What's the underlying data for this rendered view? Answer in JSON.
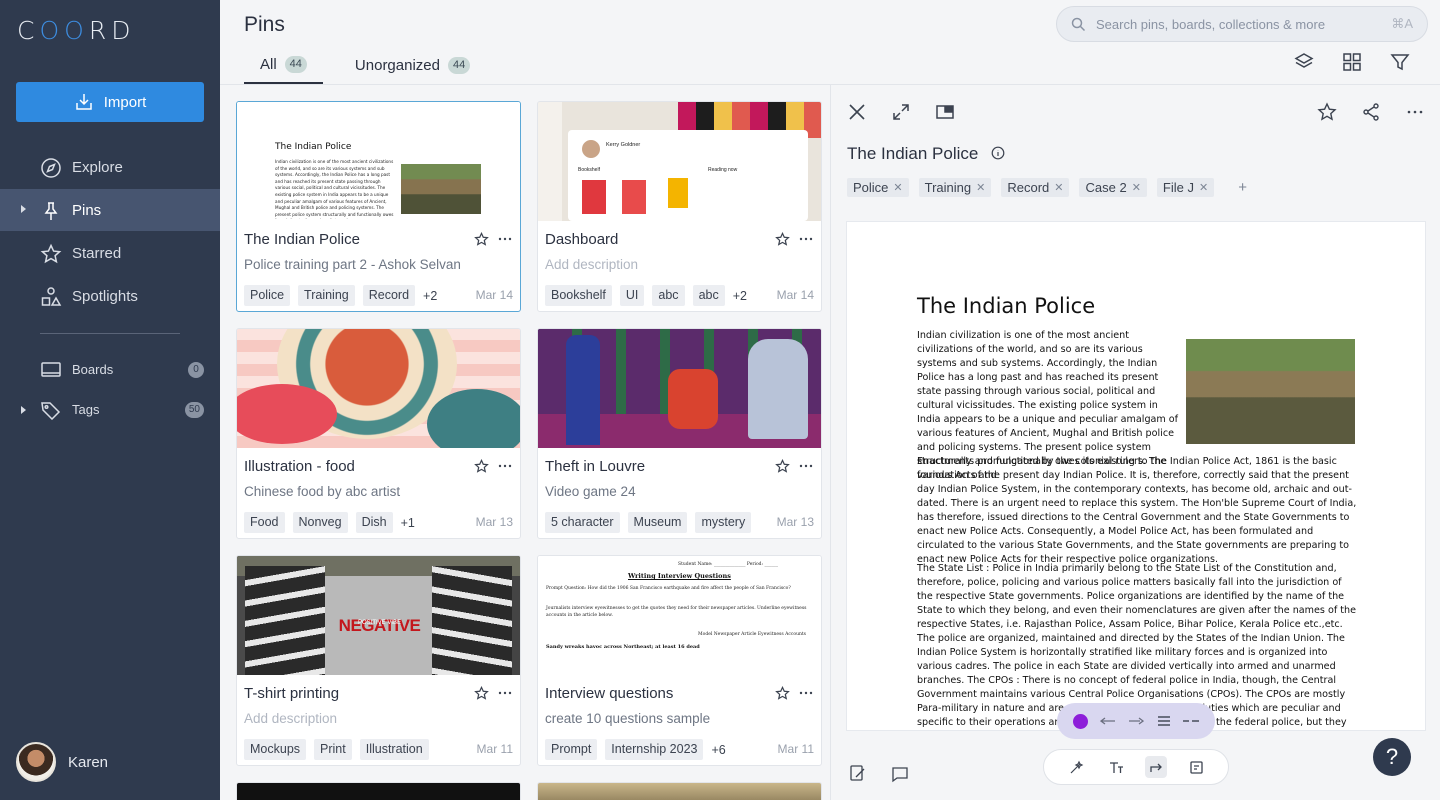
{
  "app": {
    "logo": "COORD"
  },
  "sidebar": {
    "import_label": "Import",
    "nav": [
      {
        "label": "Explore",
        "icon": "compass-icon"
      },
      {
        "label": "Pins",
        "icon": "pin-icon"
      },
      {
        "label": "Starred",
        "icon": "star-icon"
      },
      {
        "label": "Spotlights",
        "icon": "shapes-icon"
      }
    ],
    "boards": {
      "label": "Boards",
      "count": "0"
    },
    "tags": {
      "label": "Tags",
      "count": "50"
    },
    "user": {
      "name": "Karen"
    }
  },
  "header": {
    "title": "Pins",
    "search_placeholder": "Search pins, boards, collections & more",
    "search_shortcut": "⌘A",
    "tabs": [
      {
        "label": "All",
        "count": "44"
      },
      {
        "label": "Unorganized",
        "count": "44"
      }
    ]
  },
  "cards": [
    {
      "title": "The Indian Police",
      "desc": "Police training part 2 - Ashok Selvan",
      "tags": [
        "Police",
        "Training",
        "Record"
      ],
      "more": "+2",
      "date": "Mar 14"
    },
    {
      "title": "Dashboard",
      "desc": "Add description",
      "tags": [
        "Bookshelf",
        "UI",
        "abc",
        "abc"
      ],
      "more": "+2",
      "date": "Mar 14"
    },
    {
      "title": "Illustration - food",
      "desc": "Chinese food by abc artist",
      "tags": [
        "Food",
        "Nonveg",
        "Dish"
      ],
      "more": "+1",
      "date": "Mar 13"
    },
    {
      "title": "Theft in Louvre",
      "desc": "Video game 24",
      "tags": [
        "5 character",
        "Museum",
        "mystery"
      ],
      "more": "",
      "date": "Mar 13"
    },
    {
      "title": "T-shirt printing",
      "desc": "Add description",
      "tags": [
        "Mockups",
        "Print",
        "Illustration"
      ],
      "more": "",
      "date": "Mar 11"
    },
    {
      "title": "Interview questions",
      "desc": "create 10 questions sample",
      "tags": [
        "Prompt",
        "Internship 2023"
      ],
      "more": "+6",
      "date": "Mar 11"
    }
  ],
  "thumbs": {
    "police_doc_title": "The Indian Police",
    "police_doc_text": "Indian civilization is one of the most ancient civilizations of the world, and so are its various systems and sub systems. Accordingly, the Indian Police has a long past and has reached its present state passing through various social, political and cultural vicissitudes. The existing police system in India appears to be a unique and peculiar amalgam of various features of Ancient, Mughal and British police and policing systems. The present police system structurally and functionally owes its existing to the various Acts and",
    "dashboard_user": "Kerry Goldner",
    "dashboard_section1": "Bookshelf",
    "dashboard_section2": "Reading now",
    "tshirt_text": "NEGATIVE",
    "tshirt_sub": "POSITIVE VIBE",
    "interview_heading": "Writing Interview Questions",
    "interview_fields": "Student Name: ______________ Period: ______",
    "interview_prompt": "Prompt Question: How did the 1906 San Francisco earthquake and fire affect the people of San Francisco?",
    "interview_line1": "Journalists interview eyewitnesses to get the quotes they need for their newspaper articles. Underline eyewitness accounts in the article below.",
    "interview_line2": "Model Newspaper Article Eyewitness Accounts",
    "interview_line3": "Sandy wreaks havoc across Northeast; at least 16 dead"
  },
  "detail": {
    "title": "The Indian Police",
    "tags": [
      "Police",
      "Training",
      "Record",
      "Case 2",
      "File J"
    ],
    "add_tag": "+",
    "doc_title": "The Indian Police",
    "doc_p1": "Indian civilization is one of the most ancient civilizations of the world, and so are its various systems and sub systems. Accordingly, the Indian Police has a long past and has reached its present state passing through various social, political and cultural vicissitudes. The existing police system in India appears to be a unique and peculiar amalgam of various features of Ancient, Mughal and British police and policing systems. The present police system structurally and functionally owes its existing to the various Acts and",
    "doc_p1b": "Enactments promulgated by the colonial rulers. The Indian Police Act, 1861 is the basic foundation of the present day Indian Police. It is, therefore, correctly said that the present day Indian Police System, in the contemporary contexts, has become old, archaic and out-dated. There is an urgent need to replace this system. The Hon'ble Supreme Court of India, has therefore, issued directions to the Central Government and the State Governments to enact new Police Acts. Consequently, a Model Police Act, has been formulated and circulated to the various State Governments, and the State governments are preparing to enact new Police Acts for their respective police organizations.",
    "doc_p2": "The State List : Police in India primarily belong to the State List of the Constitution and, therefore, police, policing and various police matters basically fall into the jurisdiction of the respective State governments. Police organizations are identified by the name of the State to which they belong, and even their nomenclatures are given after the names of the respective States, i.e. Rajasthan Police, Assam Police, Bihar Police, Kerala Police etc.,etc. The police are organized, maintained and directed by the States of the Indian Union. The Indian Police System is horizontally stratified like military forces and is organized into various cadres. The police in each State are divided vertically into armed and unarmed branches. The CPOs : There is no concept of federal police in India, though, the Central Government maintains various Central Police Organisations (CPOs). The CPOs are mostly Para-military in nature and are assigned specific nature of duties which are peculiar and specific to their operations and functioning. The CPOs are not the federal police, but they help and assist the State Governments in exceptional circumstances.",
    "help": "?"
  },
  "colors": {
    "sidebar": "#2f3a4e",
    "accent": "#2f8ae0",
    "annotation": "#8d1ed9"
  }
}
